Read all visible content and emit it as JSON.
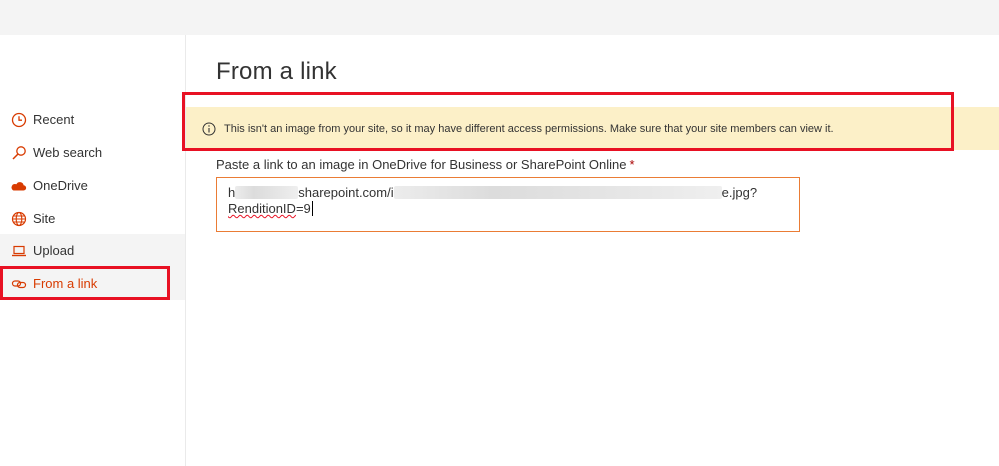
{
  "title": "From a link",
  "sidebar": {
    "items": [
      {
        "label": "Recent",
        "icon": "clock-icon"
      },
      {
        "label": "Web search",
        "icon": "search-icon"
      },
      {
        "label": "OneDrive",
        "icon": "cloud-icon"
      },
      {
        "label": "Site",
        "icon": "globe-icon"
      },
      {
        "label": "Upload",
        "icon": "laptop-icon"
      },
      {
        "label": "From a link",
        "icon": "link-icon",
        "selected": true
      }
    ]
  },
  "banner": {
    "icon": "info-icon",
    "text": "This isn't an image from your site, so it may have different access permissions. Make sure that your site members can view it."
  },
  "link_field": {
    "label": "Paste a link to an image in OneDrive for Business or SharePoint Online",
    "required_marker": "*",
    "value_line1_a": "h",
    "value_line1_b": "sharepoint.com/i",
    "value_line1_c": "e.jpg?",
    "value_line2": "RenditionID",
    "value_line2_suffix": "=9"
  },
  "colors": {
    "accent": "#d83b01",
    "highlight_box": "#e81123",
    "banner_bg": "#fcf0c8",
    "field_border": "#ea7c35"
  }
}
